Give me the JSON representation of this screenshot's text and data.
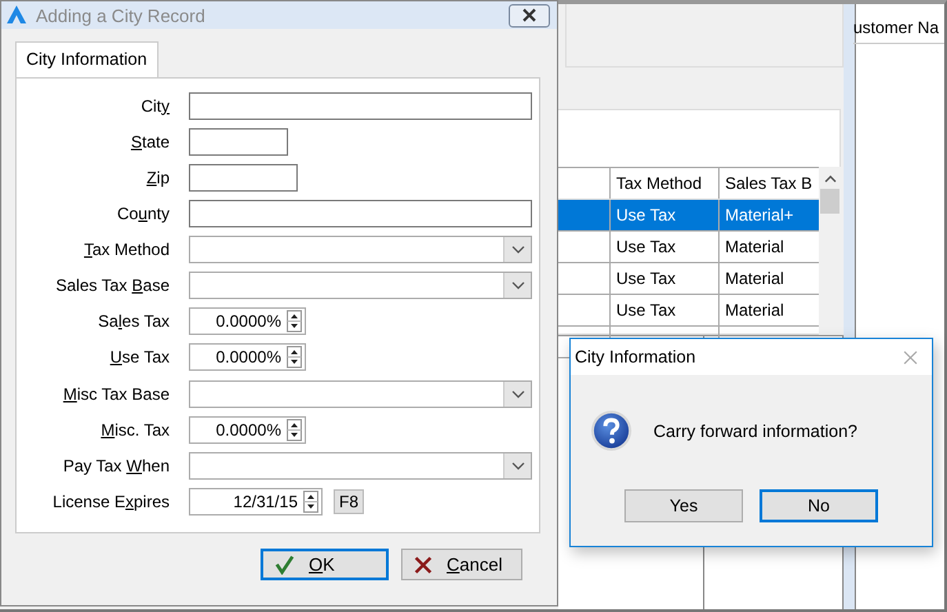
{
  "background": {
    "right_header": "ustomer Na",
    "grid": {
      "columns": [
        "Tax Method",
        "Sales Tax B"
      ],
      "rows": [
        {
          "selected": true,
          "cells": [
            "Use Tax",
            "Material+"
          ]
        },
        {
          "selected": false,
          "cells": [
            "Use Tax",
            "Material"
          ]
        },
        {
          "selected": false,
          "cells": [
            "Use Tax",
            "Material"
          ]
        },
        {
          "selected": false,
          "cells": [
            "Use Tax",
            "Material"
          ]
        }
      ]
    }
  },
  "dialog": {
    "title": "Adding a City Record",
    "active": false,
    "tabs": [
      {
        "label": "City Information",
        "selected": true
      }
    ],
    "fields": [
      {
        "kind": "text",
        "label": {
          "pre": "Cit",
          "key": "y"
        }
      },
      {
        "kind": "text",
        "label": {
          "key": "S",
          "post": "tate"
        }
      },
      {
        "kind": "text",
        "label": {
          "key": "Z",
          "post": "ip"
        }
      },
      {
        "kind": "text",
        "label": {
          "pre": "Co",
          "key": "u",
          "post": "nty"
        }
      },
      {
        "kind": "combo",
        "label": {
          "key": "T",
          "post": "ax Method"
        }
      },
      {
        "kind": "combo",
        "label": {
          "pre": "Sales Tax ",
          "key": "B",
          "post": "ase"
        }
      },
      {
        "kind": "spinner",
        "value": "0.0000%",
        "label": {
          "pre": "Sa",
          "key": "l",
          "post": "es Tax"
        }
      },
      {
        "kind": "spinner",
        "value": "0.0000%",
        "label": {
          "key": "U",
          "post": "se Tax"
        }
      },
      {
        "kind": "combo",
        "label": {
          "key": "M",
          "post": "isc Tax Base"
        }
      },
      {
        "kind": "spinner",
        "value": "0.0000%",
        "label": {
          "key": "M",
          "post": "isc. Tax"
        }
      },
      {
        "kind": "combo",
        "label": {
          "pre": "Pay Tax ",
          "key": "W",
          "post": "hen"
        }
      },
      {
        "kind": "date",
        "value": "12/31/15",
        "button": "F8",
        "label": {
          "pre": "License E",
          "key": "x",
          "post": "pires"
        }
      }
    ],
    "buttons": [
      {
        "kind": "ok",
        "focused": true,
        "label": {
          "key": "O",
          "post": "K"
        }
      },
      {
        "kind": "cancel",
        "focused": false,
        "label": {
          "key": "C",
          "post": "ancel"
        }
      }
    ]
  },
  "message_box": {
    "title": "City Information",
    "message": "Carry forward information?",
    "buttons": [
      {
        "label": "Yes",
        "focused": false
      },
      {
        "label": "No",
        "focused": true
      }
    ]
  }
}
